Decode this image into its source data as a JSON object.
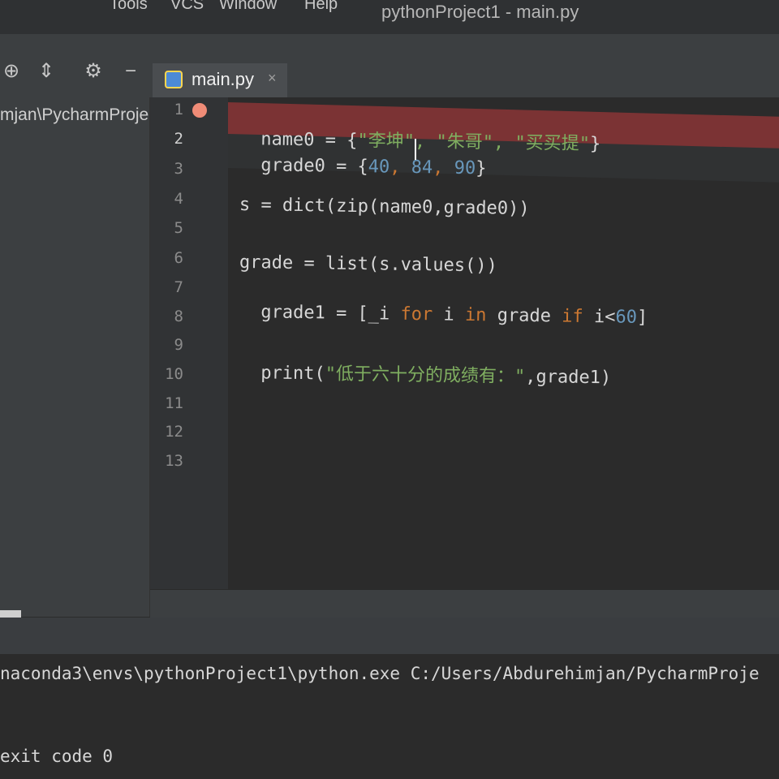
{
  "window": {
    "title": "pythonProject1 - main.py",
    "menu": [
      "Tools",
      "VCS",
      "Window",
      "Help"
    ]
  },
  "project_panel": {
    "path": "mjan\\PycharmProje"
  },
  "toolbar": {
    "icons": [
      "target-icon",
      "collapse-icon",
      "gear-icon",
      "minimize-icon"
    ]
  },
  "tab": {
    "label": "main.py",
    "close": "×",
    "icon": "python-file-icon"
  },
  "editor": {
    "line_numbers": [
      "1",
      "2",
      "3",
      "4",
      "5",
      "6",
      "7",
      "8",
      "9",
      "10",
      "11",
      "12",
      "13"
    ],
    "code": {
      "line1": {
        "a": "name0 = {",
        "b": "\"李坤\", \"朱哥\", \"买买提\"",
        "c": "}"
      },
      "line2": {
        "a": "grade0 = {",
        "b": "40",
        "c": ", ",
        "d": "84",
        "e": ", ",
        "f": "90",
        "g": "}"
      },
      "line4": "s = dict(zip(name0,grade0))",
      "line6": "grade = list(s.values())",
      "line7": {
        "a": "grade1 = [",
        "b": "_i ",
        "c": "for",
        "d": " i ",
        "e": "in",
        "f": " grade ",
        "g": "if",
        "h": " i<",
        "i": "60",
        "j": "]"
      },
      "line9": {
        "a": "print(",
        "b": "\"低于六十分的成绩有：\"",
        "c": ",grade1)"
      }
    },
    "colors": {
      "breakpoint": "#7b3334",
      "string": "#7fae60",
      "number": "#6897bb",
      "keyword": "#cc7832"
    }
  },
  "console": {
    "command": "naconda3\\envs\\pythonProject1\\python.exe C:/Users/Abdurehimjan/PycharmProje",
    "exit": "exit code 0"
  }
}
